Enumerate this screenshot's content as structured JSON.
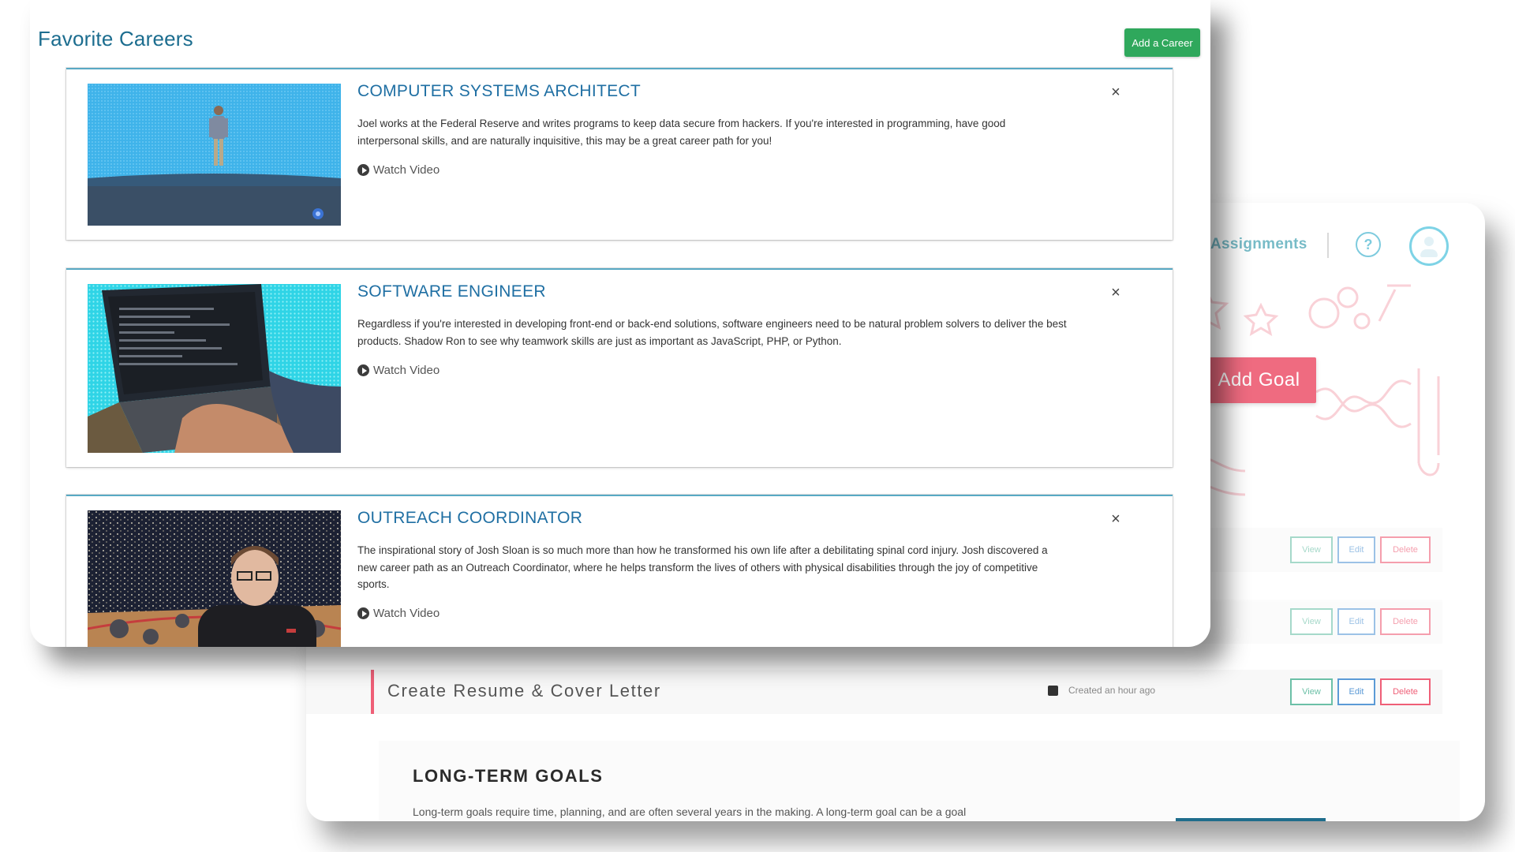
{
  "goals_page": {
    "nav_link": "Assignments",
    "help_icon": "?",
    "add_goal_label": "Add Goal",
    "goals": [
      {
        "title": "",
        "meta": "",
        "view": "View",
        "edit": "Edit",
        "delete": "Delete"
      },
      {
        "title": "",
        "meta": "",
        "view": "View",
        "edit": "Edit",
        "delete": "Delete"
      },
      {
        "title": "Create Resume & Cover Letter",
        "meta": "Created an hour ago",
        "view": "View",
        "edit": "Edit",
        "delete": "Delete"
      }
    ],
    "long_term": {
      "title": "LONG-TERM GOALS",
      "text": "Long-term goals require time, planning, and are often several years in the making. A long-term goal can be a goal"
    },
    "colors": {
      "accent_pink": "#ef6b80",
      "teal": "#1d8fa3"
    }
  },
  "favorites": {
    "title": "Favorite Careers",
    "add_button": "Add a Career",
    "careers": [
      {
        "title": "COMPUTER SYSTEMS ARCHITECT",
        "description": "Joel works at the Federal Reserve and writes programs to keep data secure from hackers. If you're interested in programming, have good interpersonal skills, and are naturally inquisitive, this may be a great career path for you!",
        "watch_label": "Watch Video",
        "close_glyph": "×"
      },
      {
        "title": "SOFTWARE ENGINEER",
        "description": "Regardless if you're interested in developing front-end or back-end solutions, software engineers need to be natural problem solvers to deliver the best products. Shadow Ron to see why teamwork skills are just as important as JavaScript, PHP, or Python.",
        "watch_label": "Watch Video",
        "close_glyph": "×"
      },
      {
        "title": "OUTREACH COORDINATOR",
        "description": "The inspirational story of Josh Sloan is so much more than how he transformed his own life after a debilitating spinal cord injury. Josh discovered a new career path as an Outreach Coordinator, where he helps transform the lives of others with physical disabilities through the joy of competitive sports.",
        "watch_label": "Watch Video",
        "close_glyph": "×"
      }
    ],
    "colors": {
      "title": "#1c6d8f",
      "add_button": "#2fa85c",
      "card_border": "#58a9c4"
    }
  }
}
